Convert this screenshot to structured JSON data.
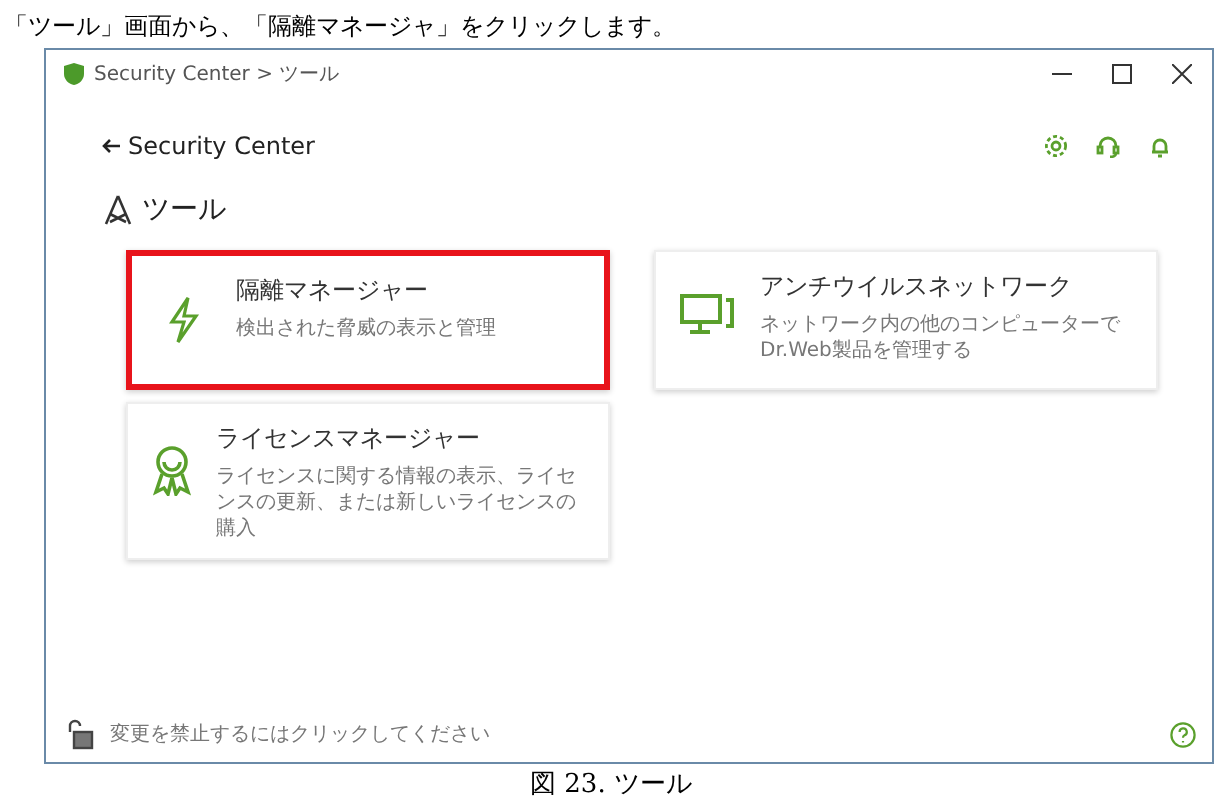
{
  "instruction": "「ツール」画面から、「隔離マネージャ」をクリックします。",
  "window": {
    "title": "Security Center > ツール"
  },
  "header": {
    "back_label": "Security Center"
  },
  "section": {
    "title": "ツール"
  },
  "cards": [
    {
      "title": "隔離マネージャー",
      "description": "検出された脅威の表示と管理",
      "highlighted": true
    },
    {
      "title": "アンチウイルスネットワーク",
      "description": "ネットワーク内の他のコンピューターでDr.Web製品を管理する",
      "highlighted": false
    },
    {
      "title": "ライセンスマネージャー",
      "description": "ライセンスに関する情報の表示、ライセンスの更新、または新しいライセンスの購入",
      "highlighted": false
    }
  ],
  "footer": {
    "lock_hint": "変更を禁止するにはクリックしてください"
  },
  "caption": "図 23.  ツール"
}
